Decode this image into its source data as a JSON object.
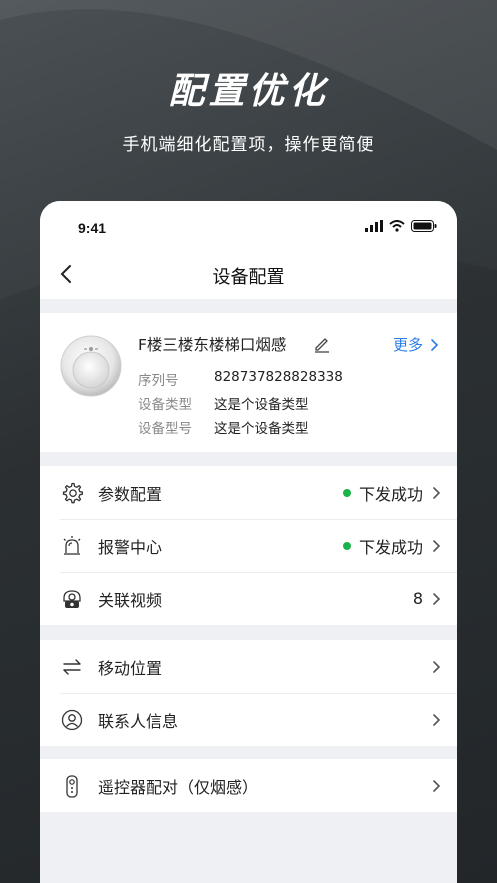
{
  "hero": {
    "title": "配置优化",
    "subtitle": "手机端细化配置项，操作更简便"
  },
  "status_bar": {
    "time": "9:41"
  },
  "nav": {
    "title": "设备配置",
    "back_icon": "chevron-left-icon"
  },
  "device": {
    "name": "F楼三楼东楼梯口烟感",
    "more_label": "更多",
    "serial_label": "序列号",
    "serial_value": "828737828828338",
    "type_label": "设备类型",
    "type_value": "这是个设备类型",
    "model_label": "设备型号",
    "model_value": "这是个设备类型"
  },
  "section1": {
    "items": [
      {
        "label": "参数配置",
        "status": "下发成功",
        "icon": "gear-icon"
      },
      {
        "label": "报警中心",
        "status": "下发成功",
        "icon": "alarm-icon"
      },
      {
        "label": "关联视频",
        "count": "8",
        "icon": "camera-icon"
      }
    ]
  },
  "section2": {
    "items": [
      {
        "label": "移动位置",
        "icon": "transfer-arrows-icon"
      },
      {
        "label": "联系人信息",
        "icon": "contact-icon"
      }
    ]
  },
  "section3": {
    "items": [
      {
        "label": "遥控器配对（仅烟感）",
        "icon": "remote-control-icon"
      }
    ]
  },
  "colors": {
    "accent": "#2b7de9",
    "success": "#19b34a",
    "background": "#eff0f4"
  }
}
